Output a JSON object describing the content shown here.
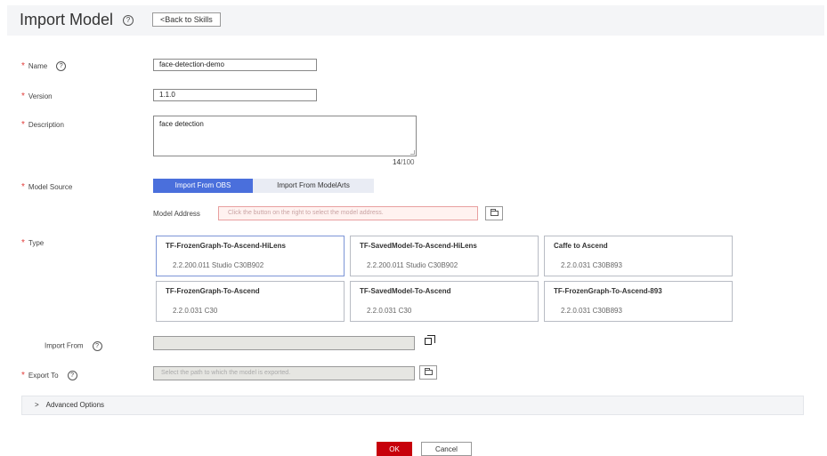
{
  "header": {
    "title": "Import Model",
    "back_label": "<Back to Skills",
    "help_glyph": "?"
  },
  "form": {
    "name": {
      "label": "Name",
      "value": "face-detection-demo"
    },
    "version": {
      "label": "Version",
      "value": "1.1.0"
    },
    "description": {
      "label": "Description",
      "value": "face detection",
      "count": "14",
      "max": "/100"
    },
    "model_source": {
      "label": "Model Source",
      "tabs": [
        "Import From OBS",
        "Import From ModelArts"
      ],
      "address_label": "Model Address",
      "address_placeholder": "Click the button on the right to select the model address."
    },
    "type": {
      "label": "Type",
      "cards": [
        {
          "title": "TF-FrozenGraph-To-Ascend-HiLens",
          "meta": "2.2.200.011  Studio  C30B902"
        },
        {
          "title": "TF-SavedModel-To-Ascend-HiLens",
          "meta": "2.2.200.011  Studio  C30B902"
        },
        {
          "title": "Caffe to Ascend",
          "meta": "2.2.0.031  C30B893"
        },
        {
          "title": "TF-FrozenGraph-To-Ascend",
          "meta": "2.2.0.031  C30"
        },
        {
          "title": "TF-SavedModel-To-Ascend",
          "meta": "2.2.0.031  C30"
        },
        {
          "title": "TF-FrozenGraph-To-Ascend-893",
          "meta": "2.2.0.031  C30B893"
        }
      ]
    },
    "import_from": {
      "label": "Import From",
      "value": ""
    },
    "export_to": {
      "label": "Export To",
      "placeholder": "Select the path to which the model is exported."
    },
    "advanced_label": "Advanced Options"
  },
  "footer": {
    "ok_label": "OK",
    "cancel_label": "Cancel"
  },
  "colors": {
    "accent": "#4a6fdc",
    "ok": "#c7000b",
    "required": "#e23c39"
  }
}
